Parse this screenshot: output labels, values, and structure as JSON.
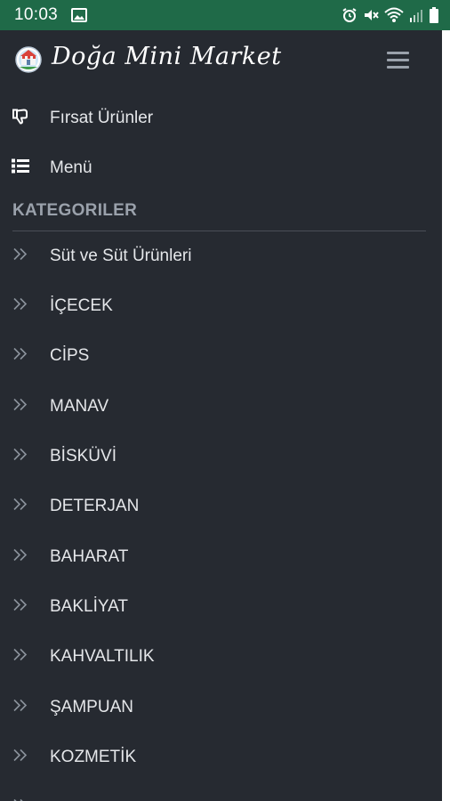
{
  "status_bar": {
    "time": "10:03",
    "icons": [
      "image-icon",
      "alarm-icon",
      "mute-icon",
      "wifi-icon",
      "signal-icon",
      "battery-icon"
    ]
  },
  "header": {
    "brand": "Doğa Mini Market",
    "logo": "store-logo",
    "menu_icon": "hamburger-icon"
  },
  "menu": {
    "firsat_label": "Fırsat Ürünler",
    "menu_label": "Menü"
  },
  "categories": {
    "title": "KATEGORILER",
    "items": [
      "Süt ve Süt Ürünleri",
      "İÇECEK",
      "CİPS",
      "MANAV",
      "BİSKÜVİ",
      "DETERJAN",
      "BAHARAT",
      "BAKLİYAT",
      "KAHVALTILIK",
      "ŞAMPUAN",
      "KOZMETİK"
    ]
  },
  "colors": {
    "status_bar": "#1f6a48",
    "drawer_bg": "#262a31",
    "text": "#e5e7ea",
    "section": "#9aa1ab"
  }
}
